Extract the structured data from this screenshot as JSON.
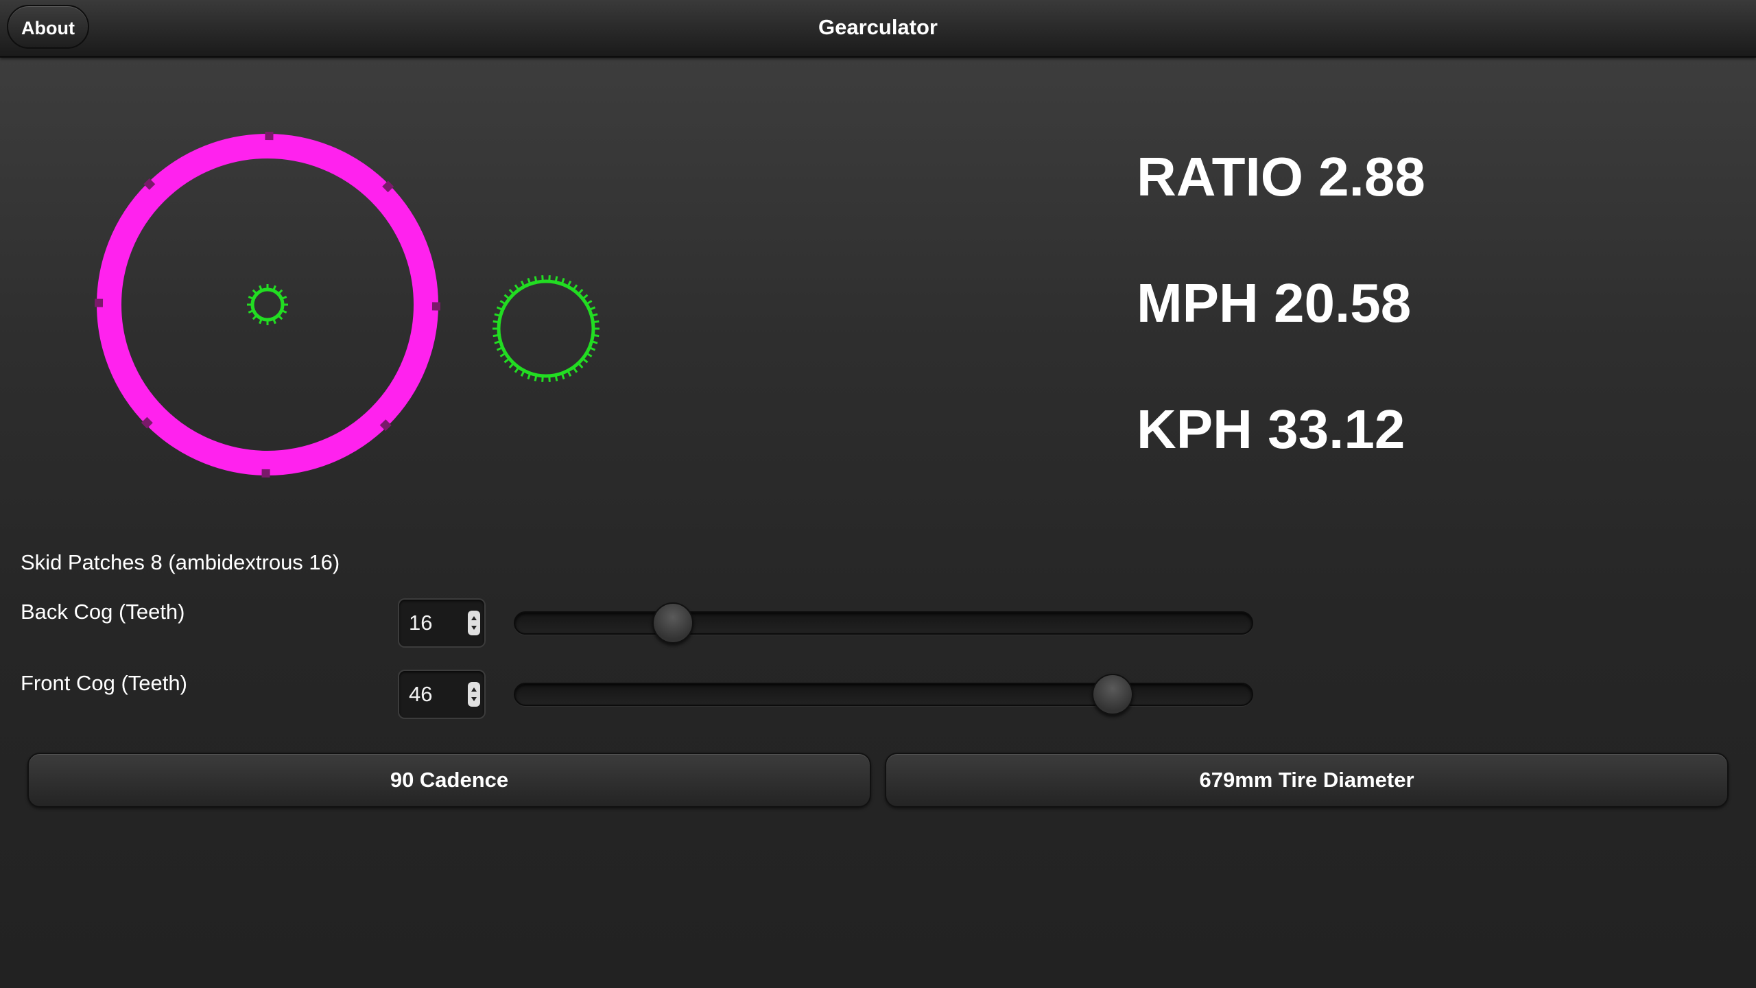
{
  "header": {
    "title": "Gearculator",
    "about_label": "About"
  },
  "stats": {
    "ratio": "RATIO 2.88",
    "mph": "MPH 20.58",
    "kph": "KPH 33.12"
  },
  "gear_visual": {
    "wheel_color": "#ff22ee",
    "cog_color": "#22dd22",
    "skid_marker_count": 8
  },
  "skid_patches": "Skid Patches 8 (ambidextrous 16)",
  "back_cog": {
    "label": "Back Cog (Teeth)",
    "value": "16",
    "slider_fraction": 0.215
  },
  "front_cog": {
    "label": "Front Cog (Teeth)",
    "value": "46",
    "slider_fraction": 0.81
  },
  "buttons": {
    "cadence": "90 Cadence",
    "tire": "679mm Tire Diameter"
  }
}
